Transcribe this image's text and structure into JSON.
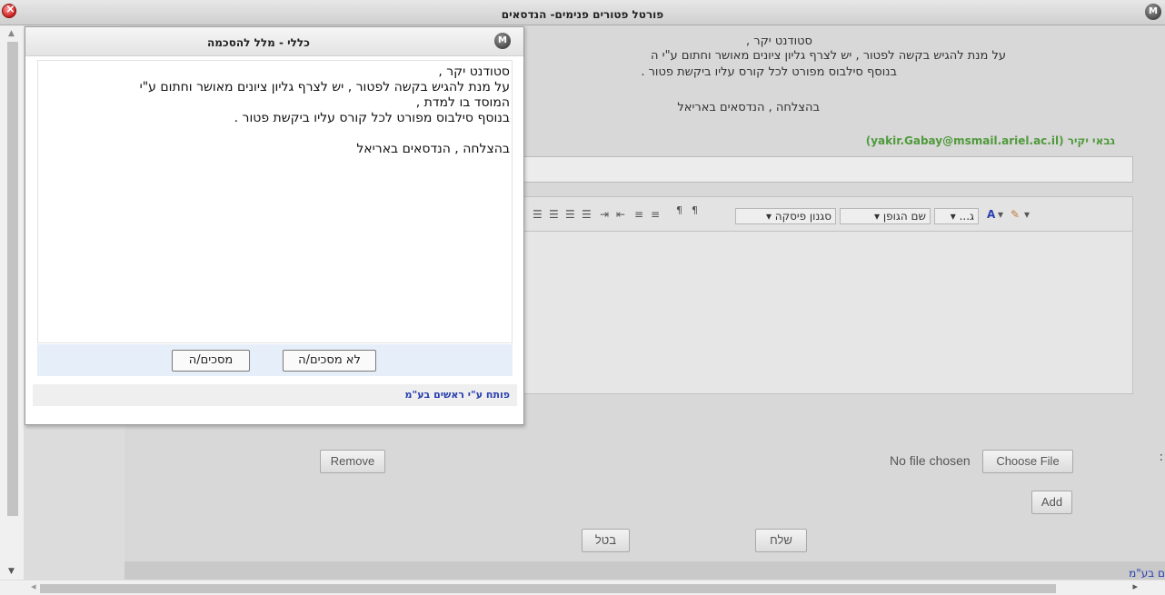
{
  "window": {
    "title": "פורטל פטורים פנימים- הנדסאים",
    "logo_text": "M"
  },
  "background": {
    "greeting": "סטודנט יקר ,",
    "line1": "על מנת להגיש בקשה  לפטור , יש לצרף גליון ציונים מאושר וחתום ע\"י ה",
    "line2": "בנוסף סילבוס מפורט לכל קורס עליו ביקשת פטור .",
    "closing": "בהצלחה , הנדסאים באריאל",
    "contact": "גבאי יקיר (yakir.Gabay@msmail.ariel.ac.il)",
    "editor": {
      "style_combo": "סגנון פיסקה",
      "font_combo": "שם הגופן",
      "size_combo": "ג...",
      "font_color": "A",
      "bg_color": "⛶"
    },
    "file": {
      "status": "No file chosen",
      "choose_label": "Choose File",
      "remove_label": "Remove",
      "add_label": "Add"
    },
    "send_label": "שלח",
    "cancel_label": "בטל",
    "colon": ":",
    "bottom_link": "ם בע\"מ"
  },
  "modal": {
    "title": "כללי - מלל להסכמה",
    "logo_text": "M",
    "message": {
      "greeting": "סטודנט יקר ,",
      "line1": "על מנת להגיש בקשה  לפטור , יש לצרף גליון ציונים מאושר וחתום ע\"י",
      "line2": "המוסד בו למדת ,",
      "line3": "בנוסף סילבוס מפורט לכל קורס עליו ביקשת פטור .",
      "closing": "בהצלחה , הנדסאים באריאל"
    },
    "disagree_label": "לא מסכים/ה",
    "agree_label": "מסכים/ה",
    "footer": "פותח ע\"י ראשים בע\"מ"
  }
}
